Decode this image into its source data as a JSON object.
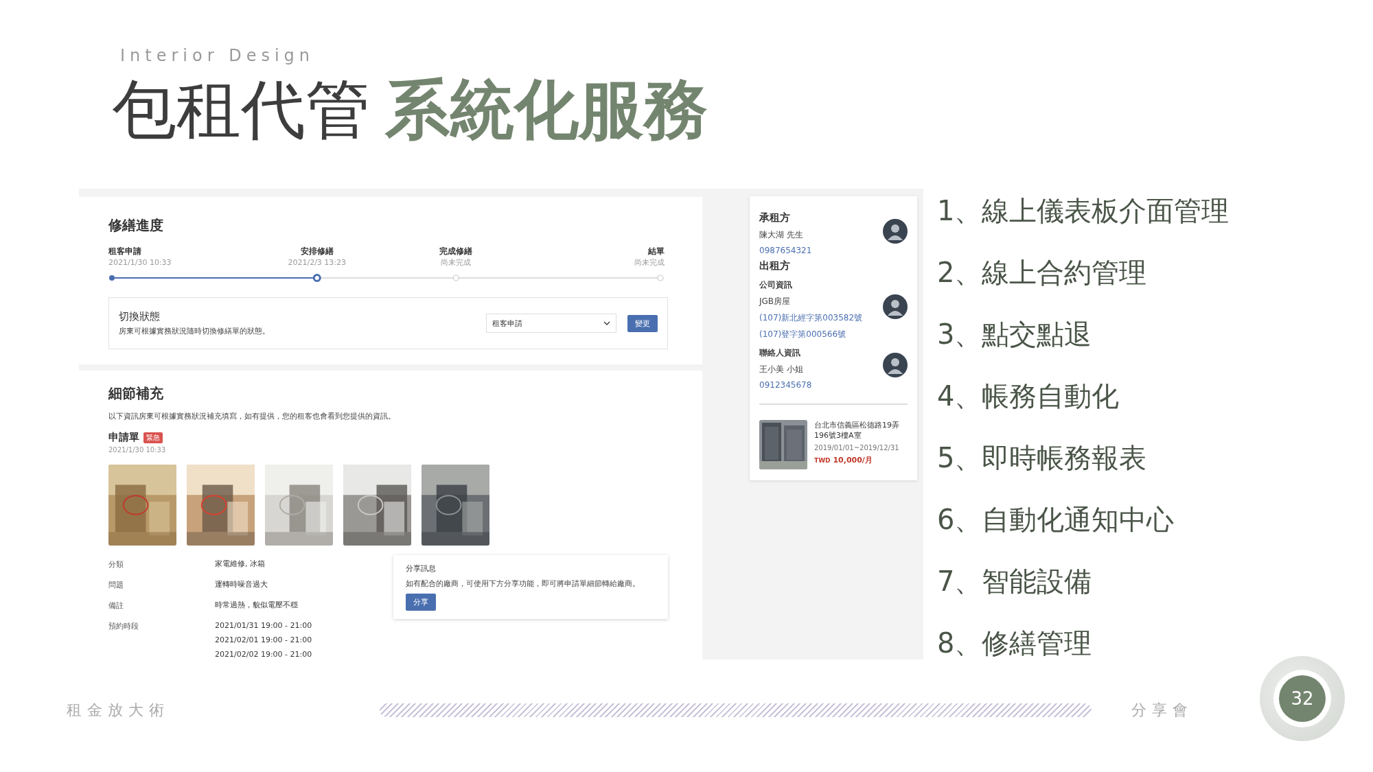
{
  "header": {
    "kicker": "Interior Design",
    "title_plain": "包租代管",
    "title_accent": "系統化服務"
  },
  "screenshot": {
    "progress": {
      "title": "修繕進度",
      "steps": [
        {
          "label": "租客申請",
          "time": "2021/1/30 10:33",
          "done": true,
          "active": false
        },
        {
          "label": "安排修繕",
          "time": "2021/2/3 13:23",
          "done": false,
          "active": true
        },
        {
          "label": "完成修繕",
          "time": "尚未完成",
          "done": false,
          "active": false
        },
        {
          "label": "結單",
          "time": "尚未完成",
          "done": false,
          "active": false
        }
      ],
      "switch_panel": {
        "title": "切換狀態",
        "description": "房東可根據實務狀況隨時切換修繕單的狀態。",
        "dropdown_value": "租客申請",
        "button": "變更"
      }
    },
    "details": {
      "title": "細節補充",
      "description": "以下資訊房東可根據實務狀況補充填寫，如有提供，您的租客也會看到您提供的資訊。",
      "form_title": "申請單",
      "badge": "緊急",
      "date": "2021/1/30 10:33",
      "fields": [
        {
          "label": "分類",
          "values": [
            "家電維修, 冰箱"
          ]
        },
        {
          "label": "問題",
          "values": [
            "運轉時噪音過大"
          ]
        },
        {
          "label": "備註",
          "values": [
            "時常過熱，貌似電壓不穩"
          ]
        },
        {
          "label": "預約時段",
          "values": [
            "2021/01/31 19:00 - 21:00",
            "2021/02/01 19:00 - 21:00",
            "2021/02/02 19:00 - 21:00"
          ]
        }
      ],
      "share": {
        "title": "分享訊息",
        "text": "如有配合的廠商，可使用下方分享功能，即可將申請單細節轉給廠商。",
        "button": "分享"
      }
    },
    "parties": {
      "blocks": [
        {
          "title": "承租方",
          "kind": "heading",
          "avatar": true,
          "lines": [
            {
              "text": "陳大湖 先生",
              "kind": "plain"
            },
            {
              "text": "0987654321",
              "kind": "link"
            }
          ]
        },
        {
          "title": "出租方",
          "kind": "heading",
          "avatar": false
        },
        {
          "title": "公司資訊",
          "kind": "subheading",
          "avatar": true,
          "lines": [
            {
              "text": "JGB房屋",
              "kind": "plain"
            },
            {
              "text": "(107)新北經字第003582號",
              "kind": "link"
            },
            {
              "text": "(107)登字第000566號",
              "kind": "link"
            }
          ]
        },
        {
          "title": "聯絡人資訊",
          "kind": "subheading",
          "avatar": true,
          "lines": [
            {
              "text": "王小美 小姐",
              "kind": "plain"
            },
            {
              "text": "0912345678",
              "kind": "link"
            }
          ]
        }
      ],
      "listing": {
        "address": "台北市信義區松德路19弄196號3樓A室",
        "period": "2019/01/01~2019/12/31",
        "currency": "TWD",
        "price": "10,000/月"
      }
    }
  },
  "features": [
    "1、線上儀表板介面管理",
    "2、線上合約管理",
    "3、點交點退",
    "4、帳務自動化",
    "5、即時帳務報表",
    "6、自動化通知中心",
    "7、智能設備",
    "8、修繕管理"
  ],
  "footer": {
    "left": "租金放大術",
    "right": "分享會",
    "page_number": "32"
  }
}
